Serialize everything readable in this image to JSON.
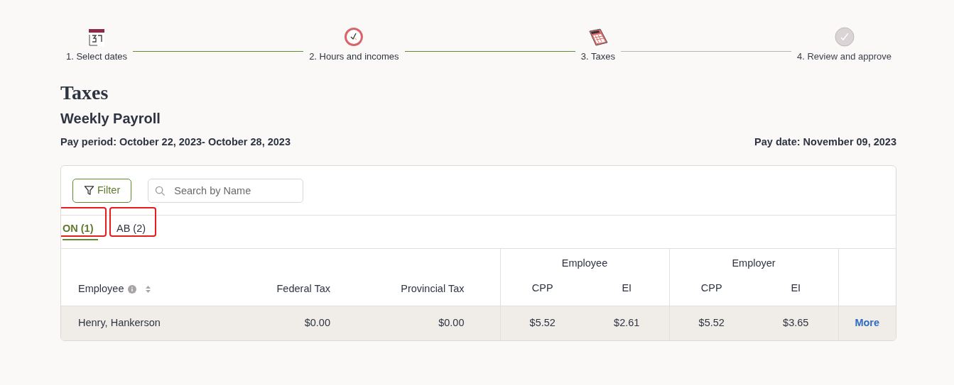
{
  "steps": [
    {
      "label": "1. Select dates",
      "reached": true
    },
    {
      "label": "2. Hours and incomes",
      "reached": true
    },
    {
      "label": "3. Taxes",
      "reached": true
    },
    {
      "label": "4. Review and approve",
      "reached": false
    }
  ],
  "page_title": "Taxes",
  "subtitle": "Weekly Payroll",
  "pay_period": "Pay period: October 22, 2023- October 28, 2023",
  "pay_date": "Pay date: November 09, 2023",
  "filter_button": "Filter",
  "search": {
    "placeholder": "Search by Name"
  },
  "tabs": [
    {
      "label": "ON (1)",
      "selected": true,
      "highlighted": true
    },
    {
      "label": "AB (2)",
      "selected": false,
      "highlighted": true
    }
  ],
  "table": {
    "groups": [
      "Employee",
      "Employer"
    ],
    "columns": {
      "employee": "Employee",
      "federal": "Federal Tax",
      "provincial": "Provincial Tax",
      "sub": [
        "CPP",
        "EI",
        "CPP",
        "EI"
      ]
    },
    "rows": [
      {
        "name": "Henry, Hankerson",
        "federal": "$0.00",
        "provincial": "$0.00",
        "amounts": [
          "$5.52",
          "$2.61",
          "$5.52",
          "$3.65"
        ],
        "action": "More"
      }
    ]
  }
}
